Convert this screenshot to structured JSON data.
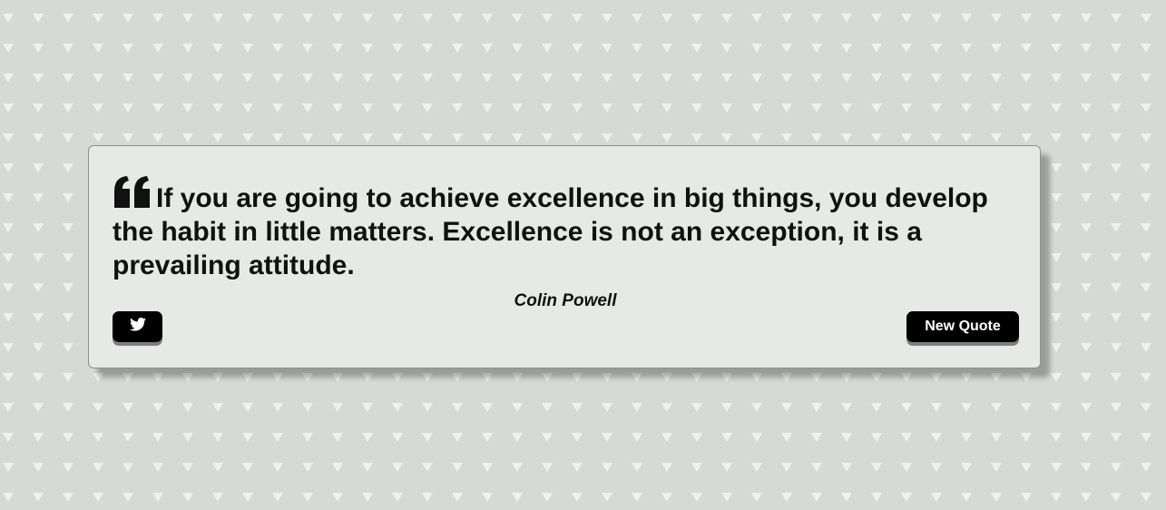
{
  "quote": {
    "icon": "quote-left-icon",
    "text": "If you are going to achieve excellence in big things, you develop the habit in little matters. Excellence is not an exception, it is a prevailing attitude.",
    "author": "Colin Powell"
  },
  "actions": {
    "tweet_icon": "twitter-icon",
    "new_quote_label": "New Quote"
  },
  "colors": {
    "background": "#d5dad5",
    "pattern": "#e8ece8",
    "card": "#e6e9e6",
    "button": "#000000",
    "button_text": "#ffffff",
    "text": "#111111"
  }
}
